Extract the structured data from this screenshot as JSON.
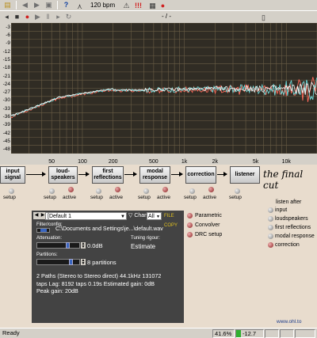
{
  "toolbar": {
    "bpm": "120 bpm",
    "position": "- / -"
  },
  "plot": {
    "y_ticks": [
      "-3",
      "-6",
      "-9",
      "-12",
      "-15",
      "-18",
      "-21",
      "-24",
      "-27",
      "-30",
      "-33",
      "-36",
      "-39",
      "-42",
      "-45",
      "-48"
    ],
    "x_ticks": [
      "50",
      "100",
      "200",
      "500",
      "1k",
      "2k",
      "5k",
      "10k"
    ]
  },
  "flow": {
    "boxes": [
      {
        "label": "input signal"
      },
      {
        "label": "loud- speakers"
      },
      {
        "label": "first reflections"
      },
      {
        "label": "modal response"
      },
      {
        "label": "correction"
      },
      {
        "label": "listener"
      }
    ],
    "final_text": "the final cut",
    "setup_label": "setup",
    "active_label": "active"
  },
  "panel": {
    "preset": "[Default 1",
    "chan_label": "Chan",
    "chan_value": "All",
    "file_copy": "FILE COPY",
    "filter_label": "Filter/config:",
    "filter_path": "C:\\Documents and Settings\\je...\\default.wav",
    "attenuation_label": "Attenuation:",
    "attenuation_value": "0.0dB",
    "tuning_label": "Tuning rigour:",
    "tuning_value": "Estimate",
    "partitions_label": "Partitions:",
    "partitions_value": "8 partitions",
    "info_lines": [
      "2 Paths (Stereo to Stereo direct) 44.1kHz 131072",
      "taps Lag: 8192 taps 0.19s Estimated gain: 0dB",
      "Peak gain: 20dB"
    ]
  },
  "mode_options": [
    "Parametric",
    "Convolver",
    "DRC setup"
  ],
  "listen_after": {
    "title": "listen after",
    "options": [
      "input",
      "loudspeakers",
      "first reflections",
      "modal response",
      "correction"
    ]
  },
  "site": "www.ohl.to",
  "status": {
    "ready": "Ready",
    "percent": "41.6%",
    "level": "-12.7 dB"
  }
}
